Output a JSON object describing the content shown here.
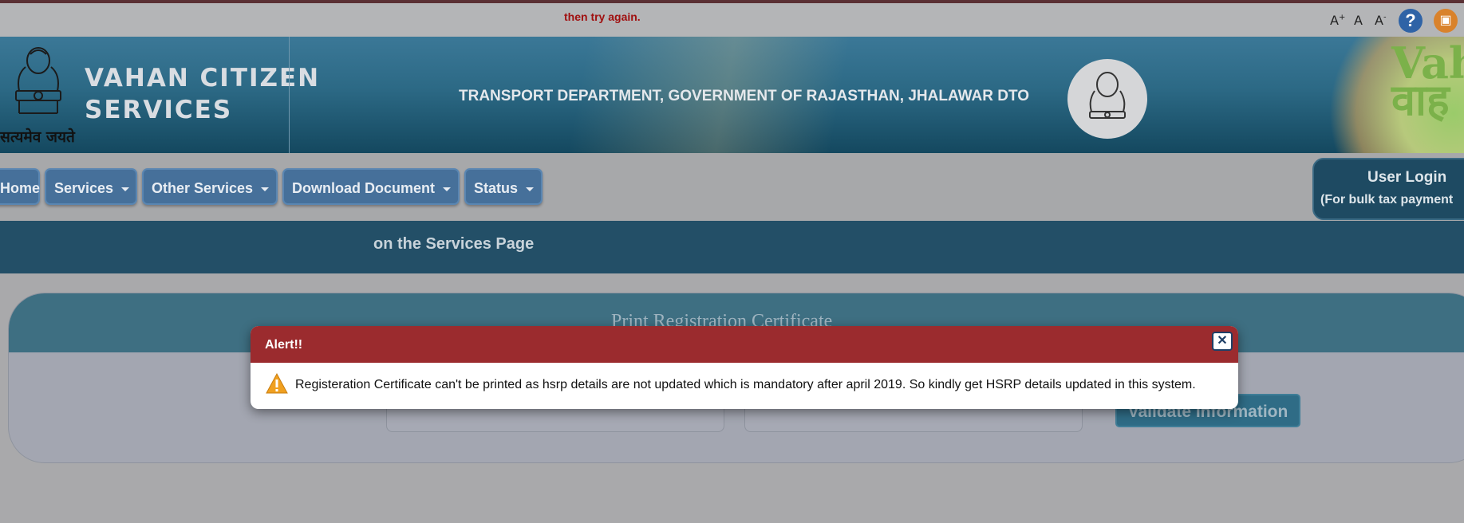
{
  "topbar": {
    "message": "then try again.",
    "font_increase": "A",
    "font_increase_sup": "+",
    "font_normal": "A",
    "font_decrease": "A",
    "font_decrease_sup": "-",
    "help_icon": "help-icon",
    "manual_icon": "book-icon"
  },
  "header": {
    "title_line1": "VAHAN CITIZEN",
    "title_line2": "SERVICES",
    "emblem_caption": "सत्यमेव जयते",
    "department": "TRANSPORT DEPARTMENT, GOVERNMENT OF RAJASTHAN, JHALAWAR DTO",
    "logo_text_line1": "Vah",
    "logo_text_line2": "वाह"
  },
  "nav": {
    "items": [
      {
        "label": "Home",
        "dropdown": false
      },
      {
        "label": "Services",
        "dropdown": true
      },
      {
        "label": "Other Services",
        "dropdown": true
      },
      {
        "label": "Download Document",
        "dropdown": true
      },
      {
        "label": "Status",
        "dropdown": true
      }
    ],
    "user_login": "User Login",
    "user_login_sub": "(For bulk tax payment"
  },
  "banner": {
    "text": "on the Services Page"
  },
  "panel": {
    "title": "Print Registration Certificate",
    "validate_label": "Validate Information"
  },
  "dialog": {
    "title": "Alert!!",
    "close_label": "✕",
    "message": "Registeration Certificate can't be printed as hsrp details are not updated which is mandatory after april 2019. So kindly get HSRP details updated in this system."
  },
  "colors": {
    "header_blue": "#2c6985",
    "nav_button": "#46709a",
    "dialog_header": "#9b2b2e",
    "banner": "#234f67",
    "overlay_gray": "#a9a9ab"
  }
}
